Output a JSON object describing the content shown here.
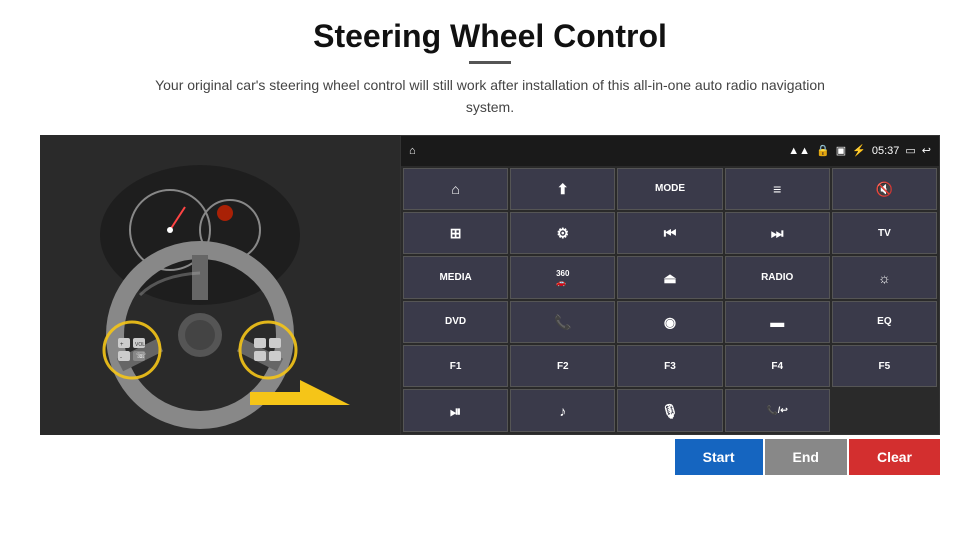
{
  "header": {
    "title": "Steering Wheel Control",
    "divider": true,
    "subtitle": "Your original car's steering wheel control will still work after installation of this all-in-one auto radio navigation system."
  },
  "statusbar": {
    "time": "05:37",
    "icons": [
      "home",
      "wifi",
      "lock",
      "sd",
      "bluetooth",
      "monitor",
      "back"
    ]
  },
  "grid_buttons": [
    {
      "id": "r1c1",
      "icon": "⌂",
      "text": "",
      "type": "icon"
    },
    {
      "id": "r1c2",
      "icon": "✈",
      "text": "",
      "type": "icon"
    },
    {
      "id": "r1c3",
      "icon": "MODE",
      "text": "MODE",
      "type": "text"
    },
    {
      "id": "r1c4",
      "icon": "☰",
      "text": "",
      "type": "icon"
    },
    {
      "id": "r1c5",
      "icon": "🔇",
      "text": "",
      "type": "icon"
    },
    {
      "id": "r1c6",
      "icon": "⊞",
      "text": "",
      "type": "icon"
    },
    {
      "id": "r2c1",
      "icon": "⚙",
      "text": "",
      "type": "icon"
    },
    {
      "id": "r2c2",
      "icon": "⏮",
      "text": "",
      "type": "icon"
    },
    {
      "id": "r2c3",
      "icon": "⏭",
      "text": "",
      "type": "icon"
    },
    {
      "id": "r2c4",
      "icon": "TV",
      "text": "TV",
      "type": "text"
    },
    {
      "id": "r2c5",
      "icon": "MEDIA",
      "text": "MEDIA",
      "type": "text"
    },
    {
      "id": "r3c1",
      "icon": "360",
      "text": "360",
      "type": "text-small"
    },
    {
      "id": "r3c2",
      "icon": "⏏",
      "text": "",
      "type": "icon"
    },
    {
      "id": "r3c3",
      "icon": "RADIO",
      "text": "RADIO",
      "type": "text"
    },
    {
      "id": "r3c4",
      "icon": "☀",
      "text": "",
      "type": "icon"
    },
    {
      "id": "r3c5",
      "icon": "DVD",
      "text": "DVD",
      "type": "text"
    },
    {
      "id": "r4c1",
      "icon": "📞",
      "text": "",
      "type": "icon"
    },
    {
      "id": "r4c2",
      "icon": "◎",
      "text": "",
      "type": "icon"
    },
    {
      "id": "r4c3",
      "icon": "▭",
      "text": "",
      "type": "icon"
    },
    {
      "id": "r4c4",
      "icon": "EQ",
      "text": "EQ",
      "type": "text"
    },
    {
      "id": "r4c5",
      "icon": "F1",
      "text": "F1",
      "type": "text"
    },
    {
      "id": "r5c1",
      "icon": "F2",
      "text": "F2",
      "type": "text"
    },
    {
      "id": "r5c2",
      "icon": "F3",
      "text": "F3",
      "type": "text"
    },
    {
      "id": "r5c3",
      "icon": "F4",
      "text": "F4",
      "type": "text"
    },
    {
      "id": "r5c4",
      "icon": "F5",
      "text": "F5",
      "type": "text"
    },
    {
      "id": "r5c5",
      "icon": "⏯",
      "text": "",
      "type": "icon"
    },
    {
      "id": "r6c1",
      "icon": "♪",
      "text": "",
      "type": "icon"
    },
    {
      "id": "r6c2",
      "icon": "🎤",
      "text": "",
      "type": "icon"
    },
    {
      "id": "r6c3",
      "icon": "📞/↩",
      "text": "",
      "type": "icon"
    }
  ],
  "bottom_buttons": {
    "start_label": "Start",
    "end_label": "End",
    "clear_label": "Clear"
  }
}
